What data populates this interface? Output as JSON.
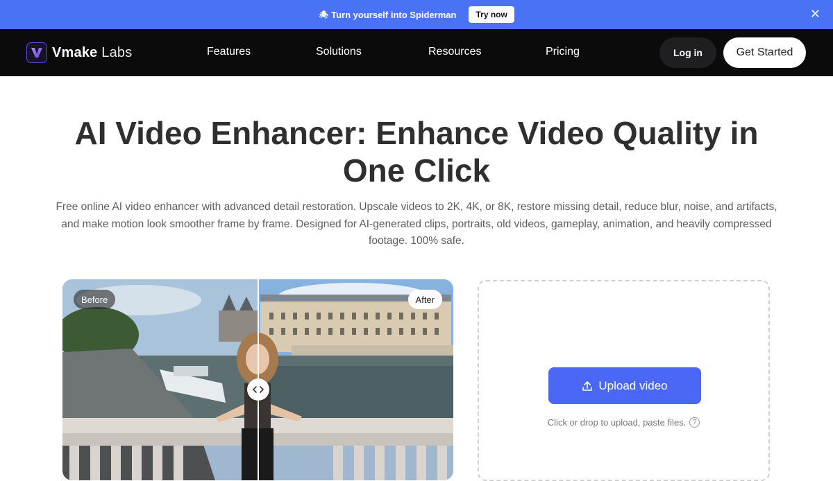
{
  "promo": {
    "emoji": "🕷",
    "text": "Turn yourself into Spiderman",
    "button": "Try now",
    "close": "✕"
  },
  "nav": {
    "brand": "Vmake",
    "brand_suffix": "Labs",
    "links": [
      "Features",
      "Solutions",
      "Resources",
      "Pricing"
    ],
    "login": "Log in",
    "get_started": "Get Started"
  },
  "hero": {
    "title": "AI Video Enhancer: Enhance Video Quality in One Click",
    "subtitle": "Free online AI video enhancer with advanced detail restoration. Upscale videos to 2K, 4K, or 8K, restore missing detail, reduce blur, noise, and artifacts, and make motion look smoother frame by frame. Designed for AI-generated clips, portraits, old videos, gameplay, animation, and heavily compressed footage. 100% safe."
  },
  "compare": {
    "before": "Before",
    "after": "After"
  },
  "upload": {
    "button": "Upload video",
    "hint": "Click or drop to upload, paste files.",
    "help": "?"
  },
  "colors": {
    "promo_bar": "#4a72f5",
    "nav_bg": "#0b0b0c",
    "upload_button": "#4a67f5",
    "logo_accent": "#8b5cf6"
  }
}
